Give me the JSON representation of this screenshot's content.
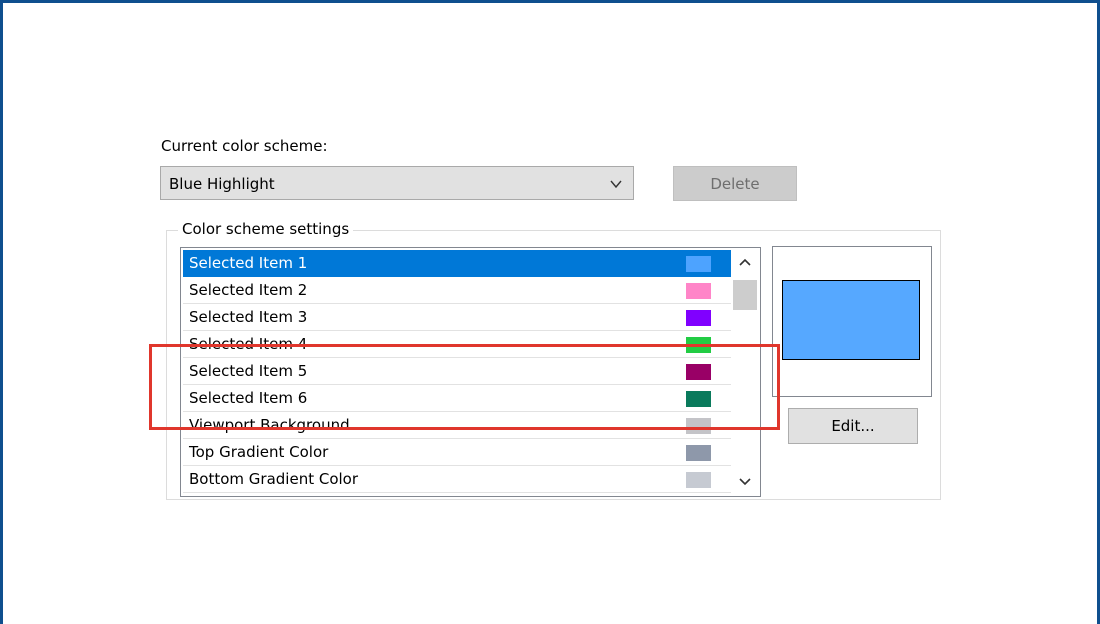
{
  "scheme": {
    "label": "Current color scheme:",
    "selected": "Blue Highlight",
    "delete_label": "Delete"
  },
  "settings": {
    "group_title": "Color scheme settings",
    "items": [
      {
        "label": "Selected Item 1",
        "color": "#4da3ff",
        "selected": true
      },
      {
        "label": "Selected Item 2",
        "color": "#ff85c8",
        "selected": false
      },
      {
        "label": "Selected Item 3",
        "color": "#8000ff",
        "selected": false
      },
      {
        "label": "Selected Item 4",
        "color": "#22cc44",
        "selected": false
      },
      {
        "label": "Selected Item 5",
        "color": "#990066",
        "selected": false
      },
      {
        "label": "Selected Item 6",
        "color": "#0a7a5c",
        "selected": false
      },
      {
        "label": "Viewport Background",
        "color": "#c4c4c8",
        "selected": false
      },
      {
        "label": "Top Gradient Color",
        "color": "#8e98aa",
        "selected": false
      },
      {
        "label": "Bottom Gradient Color",
        "color": "#c6cad2",
        "selected": false
      }
    ],
    "preview_color": "#56a8ff",
    "edit_label": "Edit..."
  },
  "colors": {
    "selection": "#0078d7",
    "annotation": "#e0362c",
    "window_border": "#0f4f8e"
  }
}
